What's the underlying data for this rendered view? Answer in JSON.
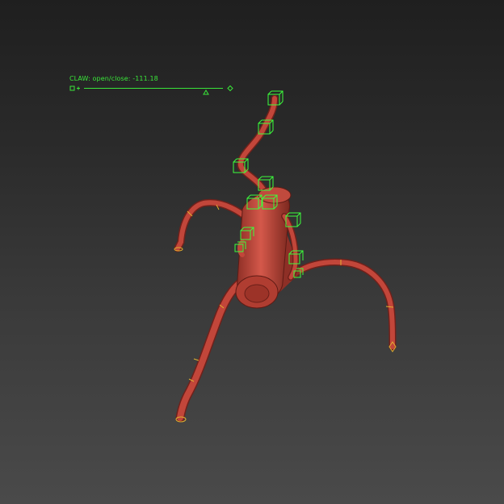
{
  "viewport": {
    "background_top": "#1f1f1f",
    "background_bottom": "#4a4a4a"
  },
  "model": {
    "body_color": "#c2463a",
    "rig_color": "#3cff3c",
    "joint_ring_color": "#e0b030"
  },
  "hud": {
    "label": "CLAW: open/close: -111.18",
    "slider_value": -111.18
  }
}
